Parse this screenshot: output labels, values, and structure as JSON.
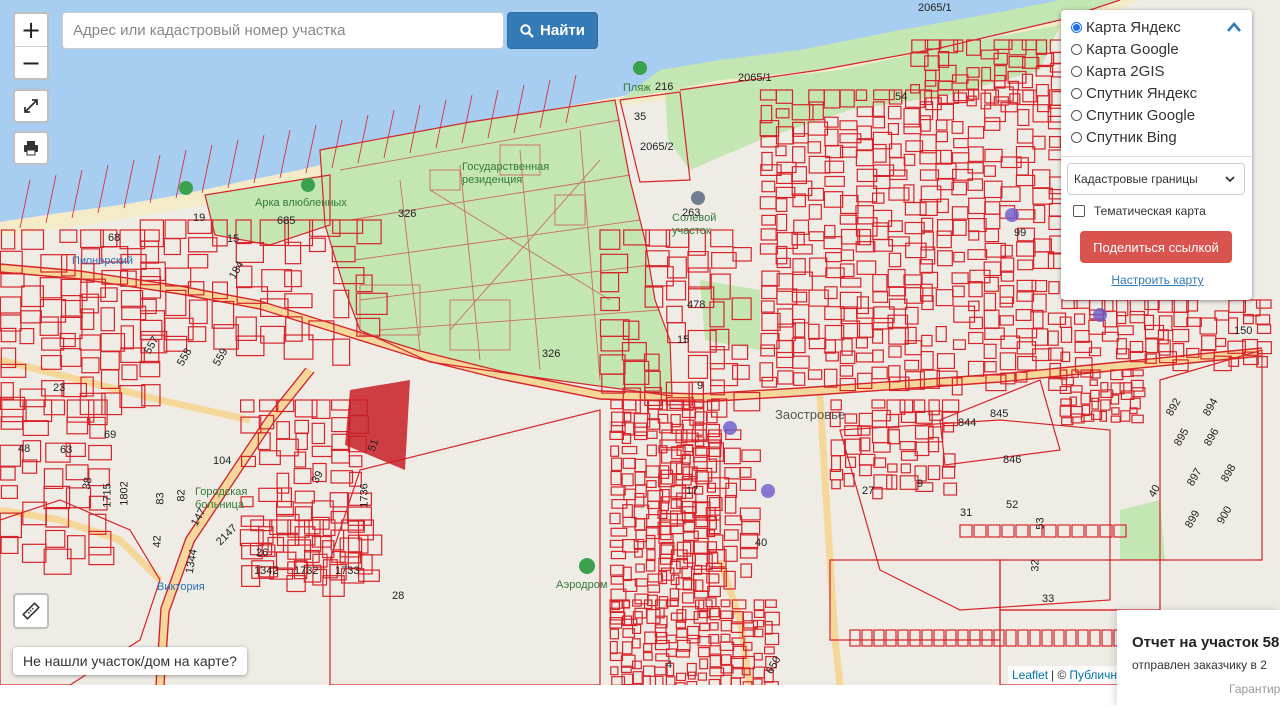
{
  "search": {
    "placeholder": "Адрес или кадастровый номер участка",
    "button_label": "Найти"
  },
  "zoom": {
    "in_label": "+",
    "out_label": "−"
  },
  "layers": {
    "options": [
      {
        "label": "Карта Яндекс",
        "selected": true
      },
      {
        "label": "Карта Google",
        "selected": false
      },
      {
        "label": "Карта 2GIS",
        "selected": false
      },
      {
        "label": "Спутник Яндекс",
        "selected": false
      },
      {
        "label": "Спутник Google",
        "selected": false
      },
      {
        "label": "Спутник Bing",
        "selected": false
      }
    ],
    "select_value": "Кадастровые границы",
    "thematic_label": "Тематическая карта",
    "thematic_checked": false,
    "share_label": "Поделиться ссылкой",
    "configure_label": "Настроить карту"
  },
  "not_found_label": "Не нашли участок/дом на карте?",
  "attribution": {
    "leaflet": "Leaflet",
    "sep": "| ©",
    "public": "Публичн"
  },
  "toast": {
    "title": "Отчет на участок 58",
    "subtitle": "отправлен заказчику в 2",
    "guarantee": "Гарантир"
  },
  "colors": {
    "water": "#a7cdf1",
    "park": "#c3e6b3",
    "land": "#efece6",
    "parcel": "#d6242a",
    "road": "#f6d79a",
    "accent": "#337ab7",
    "share": "#d9534f"
  },
  "places": [
    "Пионерский",
    "Государственная резиденция",
    "Арка влюбленных",
    "Пляж",
    "Солевой участок",
    "Виктория",
    "Аэродром",
    "Городская больница",
    "Заостровье"
  ],
  "parcel_numbers": [
    "2065/1",
    "2065/1",
    "216",
    "35",
    "2065/2",
    "263",
    "54",
    "685",
    "326",
    "326",
    "19",
    "15",
    "184",
    "68",
    "478",
    "15",
    "9",
    "99",
    "150",
    "557",
    "558",
    "559",
    "104",
    "69",
    "39",
    "51",
    "1736",
    "1715",
    "1802",
    "83",
    "82",
    "147",
    "42",
    "2147",
    "1344",
    "26",
    "1342",
    "1732",
    "1733",
    "28",
    "17",
    "40",
    "844",
    "845",
    "846",
    "27",
    "9",
    "31",
    "52",
    "53",
    "32",
    "33",
    "40",
    "892",
    "894",
    "895",
    "896",
    "897",
    "898",
    "899",
    "900",
    "4",
    "650",
    "23",
    "48",
    "63",
    "38"
  ]
}
